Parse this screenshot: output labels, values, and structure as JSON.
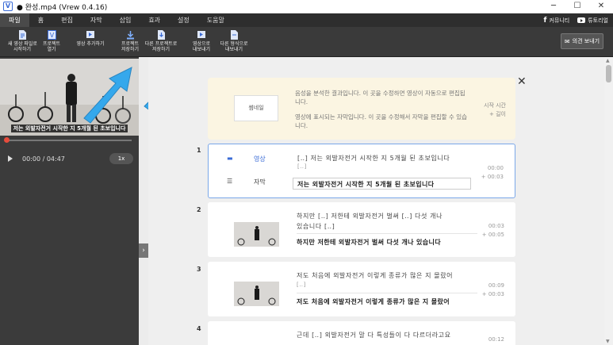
{
  "window": {
    "title": "● 완성.mp4 (Vrew 0.4.16)",
    "app_icon": "V",
    "buttons": [
      "─",
      "☐",
      "✕"
    ]
  },
  "menu": {
    "items": [
      "파일",
      "홈",
      "편집",
      "자막",
      "삽입",
      "효과",
      "설정",
      "도움말"
    ],
    "active": "파일",
    "community": "커뮤니티",
    "tutorial": "튜토리얼"
  },
  "toolbar": {
    "new_video": "새 영상 파일로\n시작하기",
    "open_project": "프로젝트\n열기",
    "add_video": "영상 추가하기",
    "save_project": "프로젝트\n저장하기",
    "save_as": "다른 프로젝트로\n저장하기",
    "export_video": "영상으로\n내보내기",
    "export_other": "다른 형식으로\n내보내기",
    "feedback": "의견 보내기"
  },
  "player": {
    "subtitle": "저는 외발자전거 시작한 지 5개월 된 초보입니다",
    "time": "00:00 / 04:47",
    "speed": "1x",
    "progress": 0
  },
  "info": {
    "thumb": "썸네일",
    "line1": "음성을 분석한 결과입니다. 이 곳을 수정하면 영상이 자동으로 편집됩니다.",
    "line2": "영상에 표시되는 자막입니다. 이 곳을 수정해서 자막을 편집할 수 있습니다.",
    "time_label": "시작 시간",
    "duration_label": "+ 길이"
  },
  "segments": [
    {
      "num": "1",
      "video_label": "영상",
      "subtitle_label": "자막",
      "speech": "[‥] 저는 외발자전거 시작한 지 5개월 된 초보입니다",
      "speech2": "[‥]",
      "subtitle": "저는 외발자전거 시작한 지 5개월 된 초보입니다",
      "start": "00:00",
      "dur": "+ 00:03"
    },
    {
      "num": "2",
      "speech": "하지만 [‥] 저한테 외발자전거 벌써 [‥] 다섯 개나",
      "speech2": "있습니다 [‥]",
      "subtitle": "하지만 저한테 외발자전거 벌써 다섯 개나 있습니다",
      "start": "00:03",
      "dur": "+ 00:05"
    },
    {
      "num": "3",
      "speech": "저도 처음에 외발자전거 이렇게 종류가 많은 지 몰랐어",
      "speech2": "[‥]",
      "subtitle": "저도 처음에 외발자전거 이렇게 종류가 많은 지 몰랐어",
      "start": "00:09",
      "dur": "+ 00:03"
    },
    {
      "num": "4",
      "speech": "근데 [‥] 외발자전거 말 다 특성들이 다 다르더라고요",
      "start": "00:12"
    }
  ],
  "colors": {
    "accent": "#3a6bd6",
    "arrow": "#35a8ec",
    "progress_knob": "#e74c3c",
    "info_bg": "#fbf5e2"
  }
}
